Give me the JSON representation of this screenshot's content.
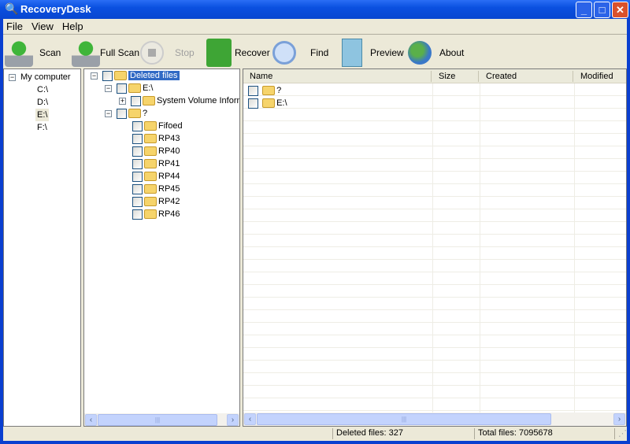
{
  "window": {
    "title": "RecoveryDesk",
    "app_icon": "magnifier-icon"
  },
  "menu": [
    "File",
    "View",
    "Help"
  ],
  "toolbar": [
    {
      "label": "Scan",
      "icon": "drive-scan-icon",
      "enabled": true
    },
    {
      "label": "Full Scan",
      "icon": "drive-full-scan-icon",
      "enabled": true
    },
    {
      "label": "Stop",
      "icon": "stop-icon",
      "enabled": false
    },
    {
      "label": "Recover",
      "icon": "floppy-disk-icon",
      "enabled": true
    },
    {
      "label": "Find",
      "icon": "magnifier-icon",
      "enabled": true
    },
    {
      "label": "Preview",
      "icon": "eye-document-icon",
      "enabled": true
    },
    {
      "label": "About",
      "icon": "globe-icon",
      "enabled": true
    }
  ],
  "drives": {
    "root": "My computer",
    "items": [
      "C:\\",
      "D:\\",
      "E:\\",
      "F:\\"
    ],
    "selected": "E:\\"
  },
  "deleted_tree": {
    "root": "Deleted files",
    "e_drive": "E:\\",
    "e_child": "System Volume Inform",
    "unknown": "?",
    "unknown_children": [
      "Fifoed",
      "RP43",
      "RP40",
      "RP41",
      "RP44",
      "RP45",
      "RP42",
      "RP46"
    ]
  },
  "file_list": {
    "columns": [
      "Name",
      "Size",
      "Created",
      "Modified"
    ],
    "rows": [
      {
        "name": "?"
      },
      {
        "name": "E:\\"
      }
    ]
  },
  "status": {
    "deleted": "Deleted files: 327",
    "total": "Total files: 7095678"
  }
}
